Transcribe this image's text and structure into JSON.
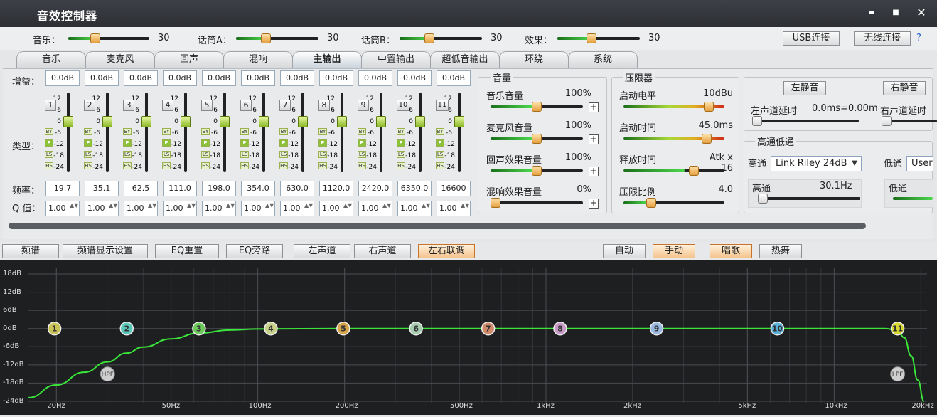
{
  "window": {
    "title": "音效控制器",
    "min_glyph": "▬",
    "max_glyph": "■",
    "close_glyph": "✕"
  },
  "top_controls": {
    "music": {
      "label": "音乐：",
      "value": "30",
      "level": 30
    },
    "mic_a": {
      "label": "话筒A：",
      "value": "30",
      "level": 30
    },
    "mic_b": {
      "label": "话筒B：",
      "value": "30",
      "level": 30
    },
    "effect": {
      "label": "效果：",
      "value": "30",
      "level": 30
    },
    "usb_button": "USB连接",
    "wireless_button": "无线连接",
    "help": "?"
  },
  "tabs": [
    "音乐",
    "麦克风",
    "回声",
    "混响",
    "主输出",
    "中置输出",
    "超低音输出",
    "环绕",
    "系统"
  ],
  "active_tab": 4,
  "eq": {
    "gain_label": "增益：",
    "type_label": "类型：",
    "freq_label": "频率：",
    "q_label": "Q 值：",
    "scale": [
      "12",
      "6",
      "0",
      "-6",
      "-12",
      "-18",
      "-24"
    ],
    "type_badges": [
      "BY",
      "P",
      "LS",
      "HS"
    ],
    "channels": [
      {
        "num": "1",
        "gain": "0.0dB",
        "freq": "19.7",
        "q": "1.00"
      },
      {
        "num": "2",
        "gain": "0.0dB",
        "freq": "35.1",
        "q": "1.00"
      },
      {
        "num": "3",
        "gain": "0.0dB",
        "freq": "62.5",
        "q": "1.00"
      },
      {
        "num": "4",
        "gain": "0.0dB",
        "freq": "111.0",
        "q": "1.00"
      },
      {
        "num": "5",
        "gain": "0.0dB",
        "freq": "198.0",
        "q": "1.00"
      },
      {
        "num": "6",
        "gain": "0.0dB",
        "freq": "354.0",
        "q": "1.00"
      },
      {
        "num": "7",
        "gain": "0.0dB",
        "freq": "630.0",
        "q": "1.00"
      },
      {
        "num": "8",
        "gain": "0.0dB",
        "freq": "1120.0",
        "q": "1.00"
      },
      {
        "num": "9",
        "gain": "0.0dB",
        "freq": "2420.0",
        "q": "1.00"
      },
      {
        "num": "10",
        "gain": "0.0dB",
        "freq": "6350.0",
        "q": "1.00"
      },
      {
        "num": "11",
        "gain": "0.0dB",
        "freq": "16600",
        "q": "1.00"
      }
    ]
  },
  "volume": {
    "title": "音量",
    "music": {
      "label": "音乐音量",
      "value": "100%",
      "level": 0.5
    },
    "mic": {
      "label": "麦克风音量",
      "value": "100%",
      "level": 0.5
    },
    "echo": {
      "label": "回声效果音量",
      "value": "100%",
      "level": 0.5
    },
    "reverb": {
      "label": "混响效果音量",
      "value": "0%",
      "level": 0.0
    }
  },
  "limiter": {
    "title": "压限器",
    "threshold": {
      "label": "启动电平",
      "value": "10dBu",
      "level": 0.88
    },
    "attack": {
      "label": "启动时间",
      "value": "45.0ms",
      "level": 0.86
    },
    "release": {
      "label": "释放时间",
      "value": "Atk x 16",
      "level": 0.72
    },
    "ratio": {
      "label": "压限比例",
      "value": "4.0",
      "level": 0.25
    }
  },
  "channel_panel": {
    "left_mute": "左静音",
    "right_mute": "右静音",
    "left_delay_label": "左声道延时",
    "left_delay_value": "0.0ms=0.00m",
    "right_delay_label": "右声道延时",
    "crossover_title": "高通低通",
    "highpass_label": "高通",
    "highpass_type": "Link Riley 24dB",
    "lowpass_label": "低通",
    "lowpass_type": "User",
    "highpass_freq_label": "高通",
    "highpass_freq": "30.1Hz",
    "lowpass_freq_label": "低通"
  },
  "toolbar": {
    "spectrum": "频谱",
    "spectrum_settings": "频谱显示设置",
    "eq_reset": "EQ重置",
    "eq_bypass": "EQ旁路",
    "left": "左声道",
    "right": "右声道",
    "link": "左右联调",
    "auto": "自动",
    "manual": "手动",
    "sing": "唱歌",
    "dance": "热舞"
  },
  "colors": {
    "curve": "#39e639",
    "title_bg": "#34373c",
    "active_button": "#f5c48e"
  },
  "chart_data": {
    "type": "line",
    "x_scale": "log",
    "xlim": [
      16,
      21000
    ],
    "ylim": [
      -24,
      18
    ],
    "ylabels": [
      "18dB",
      "12dB",
      "6dB",
      "0dB",
      "-6dB",
      "-12dB",
      "-18dB",
      "-24dB"
    ],
    "yticks": [
      18,
      12,
      6,
      0,
      -6,
      -12,
      -18,
      -24
    ],
    "xlabels": [
      "20Hz",
      "50Hz",
      "100Hz",
      "200Hz",
      "500Hz",
      "1kHz",
      "2kHz",
      "5kHz",
      "10kHz",
      "20kHz"
    ],
    "xticks": [
      20,
      50,
      100,
      200,
      500,
      1000,
      2000,
      5000,
      10000,
      20000
    ],
    "grid": true,
    "curve": {
      "x": [
        16,
        20,
        25,
        30.1,
        35,
        40,
        50,
        62.5,
        80,
        100,
        200,
        1000,
        5000,
        10000,
        15000,
        16600,
        17500,
        18500,
        19500,
        20500
      ],
      "y": [
        -22.8,
        -18.6,
        -14.4,
        -11.0,
        -8.1,
        -6.1,
        -3.4,
        -1.5,
        -0.5,
        -0.15,
        0,
        0,
        0,
        0,
        0,
        -0.6,
        -3.0,
        -9.0,
        -17.0,
        -24.0
      ]
    },
    "bands": [
      {
        "label": "1",
        "freq": 19.7,
        "gain": 0,
        "color": "#c9c35a"
      },
      {
        "label": "2",
        "freq": 35.1,
        "gain": 0,
        "color": "#5bc7b8"
      },
      {
        "label": "3",
        "freq": 62.5,
        "gain": 0,
        "color": "#6cc85a"
      },
      {
        "label": "4",
        "freq": 111.0,
        "gain": 0,
        "color": "#c9d28a"
      },
      {
        "label": "5",
        "freq": 198.0,
        "gain": 0,
        "color": "#d6a54a"
      },
      {
        "label": "6",
        "freq": 354.0,
        "gain": 0,
        "color": "#a8ccb0"
      },
      {
        "label": "7",
        "freq": 630.0,
        "gain": 0,
        "color": "#d08a6a"
      },
      {
        "label": "8",
        "freq": 1120.0,
        "gain": 0,
        "color": "#c89ac8"
      },
      {
        "label": "9",
        "freq": 2420.0,
        "gain": 0,
        "color": "#9ab8e0"
      },
      {
        "label": "10",
        "freq": 6350.0,
        "gain": 0,
        "color": "#5ab0d8"
      },
      {
        "label": "11",
        "freq": 16600,
        "gain": 0,
        "color": "#d8d830"
      }
    ],
    "filters": [
      {
        "label": "HPF",
        "freq": 30.1,
        "gain": -15
      },
      {
        "label": "LPF",
        "freq": 16600,
        "gain": -15
      }
    ]
  }
}
